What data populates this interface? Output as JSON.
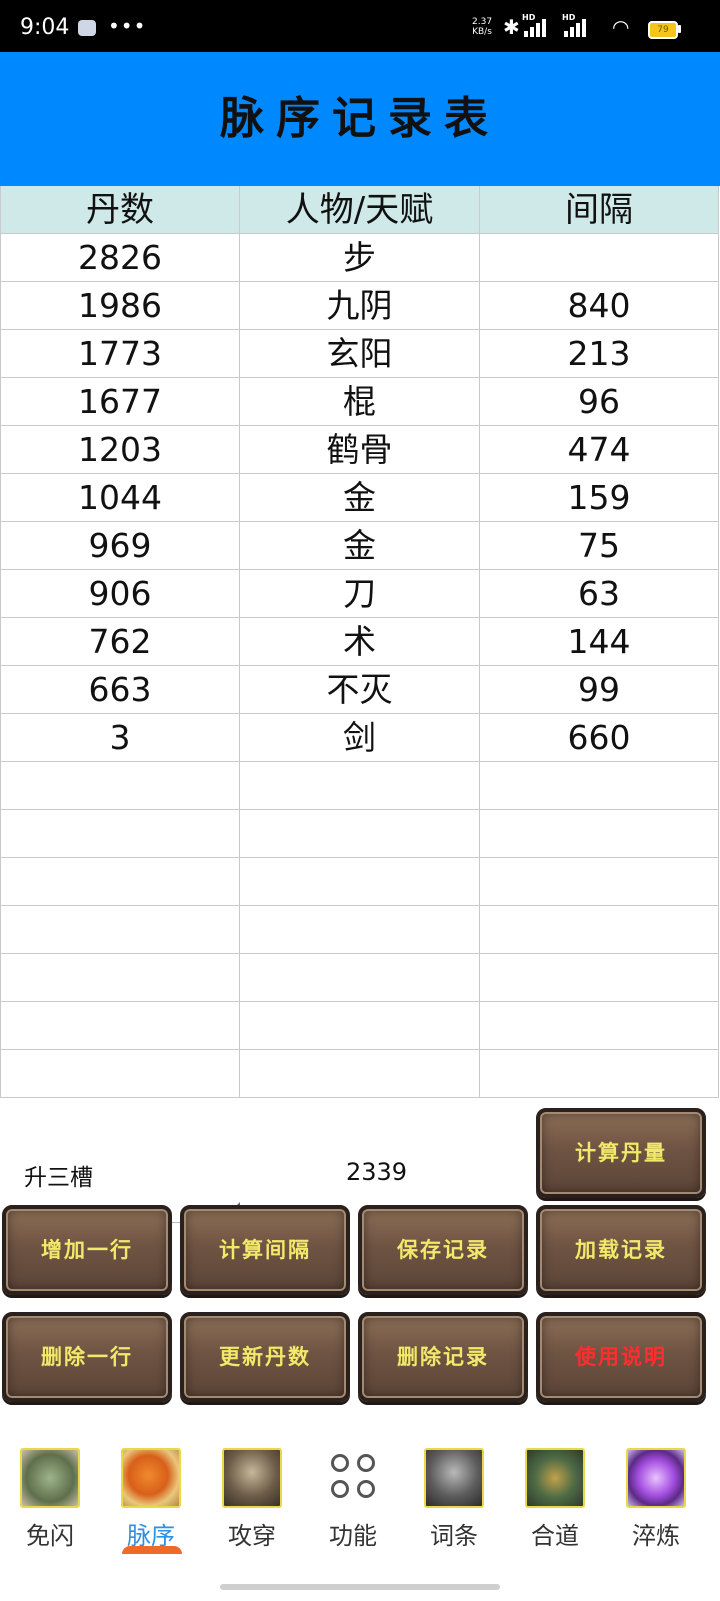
{
  "status_bar": {
    "time": "9:04",
    "more": "•••",
    "net_speed_value": "2.37",
    "net_speed_unit": "KB/s",
    "bluetooth": "bluetooth-icon",
    "hd1": "HD",
    "hd2": "HD",
    "wifi": "wifi-icon",
    "battery": "79"
  },
  "header": {
    "title": "脉序记录表"
  },
  "table": {
    "columns": [
      "丹数",
      "人物/天赋",
      "间隔"
    ],
    "rows": [
      [
        "2826",
        "步",
        ""
      ],
      [
        "1986",
        "九阴",
        "840"
      ],
      [
        "1773",
        "玄阳",
        "213"
      ],
      [
        "1677",
        "棍",
        "96"
      ],
      [
        "1203",
        "鹤骨",
        "474"
      ],
      [
        "1044",
        "金",
        "159"
      ],
      [
        "969",
        "金",
        "75"
      ],
      [
        "906",
        "刀",
        "63"
      ],
      [
        "762",
        "术",
        "144"
      ],
      [
        "663",
        "不灭",
        "99"
      ],
      [
        "3",
        "剑",
        "660"
      ],
      [
        "",
        "",
        ""
      ],
      [
        "",
        "",
        ""
      ],
      [
        "",
        "",
        ""
      ],
      [
        "",
        "",
        ""
      ],
      [
        "",
        "",
        ""
      ],
      [
        "",
        "",
        ""
      ],
      [
        "",
        "",
        ""
      ]
    ]
  },
  "controls": {
    "spinner_value": "升三槽",
    "dan_value": "2339",
    "calc_dan_label": "计算丹量",
    "buttons_row1": [
      "增加一行",
      "计算间隔",
      "保存记录",
      "加载记录"
    ],
    "buttons_row2": [
      "删除一行",
      "更新丹数",
      "删除记录",
      "使用说明"
    ]
  },
  "bottom_nav": {
    "items": [
      {
        "label": "免闪",
        "icon": "crossed-arms-icon"
      },
      {
        "label": "脉序",
        "icon": "orange-bowl-icon"
      },
      {
        "label": "攻穿",
        "icon": "armored-warrior-icon"
      },
      {
        "label": "功能",
        "icon": "grid-circles-icon"
      },
      {
        "label": "词条",
        "icon": "knight-icon"
      },
      {
        "label": "合道",
        "icon": "bronze-compass-icon"
      },
      {
        "label": "淬炼",
        "icon": "purple-crystal-icon"
      }
    ],
    "active_index": 1
  },
  "colors": {
    "header_bg": "#0088ff",
    "table_head_bg": "#cfe9e9",
    "button_text": "#f2e86a",
    "button_text_alert": "#ff2d2d",
    "nav_active": "#2f8fe0"
  }
}
